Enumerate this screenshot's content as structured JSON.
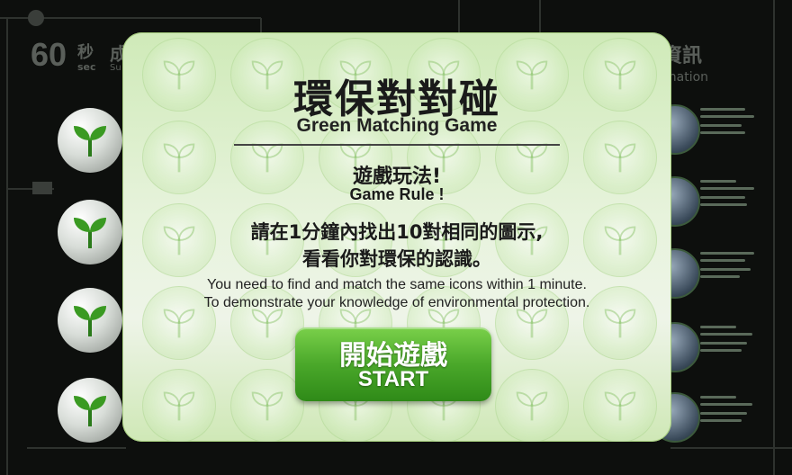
{
  "background": {
    "timer_value": "60",
    "timer_unit_zh": "秒",
    "timer_unit_en": "sec",
    "score_label_zh": "成",
    "score_label_en": "Su",
    "info_title": "資訊",
    "info_subtitle": "mation",
    "tiles": [
      "sprout-icon",
      "sprout-icon",
      "sprout-icon",
      "sprout-icon"
    ]
  },
  "modal": {
    "title_zh": "環保對對碰",
    "title_en": "Green Matching Game",
    "rule_title_zh": "遊戲玩法!",
    "rule_title_en": "Game Rule !",
    "description_zh_line1": "請在1分鐘內找出10對相同的圖示,",
    "description_zh_line2": "看看你對環保的認識。",
    "description_en_line1": "You need to find and match the same icons within 1 minute.",
    "description_en_line2": "To demonstrate your knowledge of environmental protection.",
    "start_button_zh": "開始遊戲",
    "start_button_en": "START"
  },
  "colors": {
    "accent_green": "#4aa82a",
    "modal_bg": "#e7f3dc",
    "board_bg": "#0d0f0d"
  }
}
